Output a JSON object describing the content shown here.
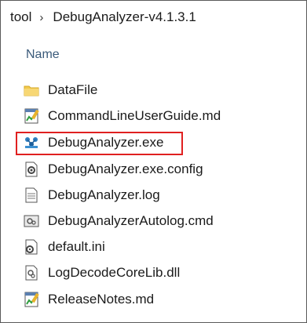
{
  "breadcrumb": {
    "parent": "tool",
    "separator": "›",
    "current": "DebugAnalyzer-v4.1.3.1"
  },
  "columns": {
    "name": "Name"
  },
  "files": [
    {
      "label": "DataFile",
      "icon": "folder-icon"
    },
    {
      "label": "CommandLineUserGuide.md",
      "icon": "notepad-file-icon"
    },
    {
      "label": "DebugAnalyzer.exe",
      "icon": "application-icon",
      "highlighted": true
    },
    {
      "label": "DebugAnalyzer.exe.config",
      "icon": "config-file-icon"
    },
    {
      "label": "DebugAnalyzer.log",
      "icon": "text-file-icon"
    },
    {
      "label": "DebugAnalyzerAutolog.cmd",
      "icon": "cmd-file-icon"
    },
    {
      "label": "default.ini",
      "icon": "ini-file-icon"
    },
    {
      "label": "LogDecodeCoreLib.dll",
      "icon": "dll-file-icon"
    },
    {
      "label": "ReleaseNotes.md",
      "icon": "notepad-file-icon"
    }
  ],
  "colors": {
    "highlight_border": "#e02020",
    "folder": "#f2c94c",
    "header_text": "#3a5a7a"
  }
}
